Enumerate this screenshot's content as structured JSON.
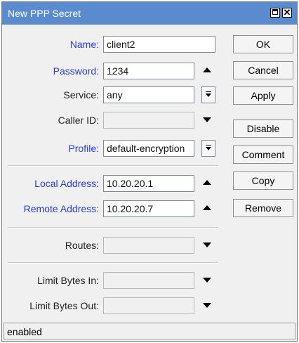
{
  "window": {
    "title": "New PPP Secret",
    "maximize_icon": "maximize-icon",
    "close_icon": "close-icon",
    "close_glyph": "✕"
  },
  "form": {
    "name": {
      "label": "Name:",
      "value": "client2"
    },
    "password": {
      "label": "Password:",
      "value": "1234"
    },
    "service": {
      "label": "Service:",
      "value": "any"
    },
    "caller_id": {
      "label": "Caller ID:",
      "value": ""
    },
    "profile": {
      "label": "Profile:",
      "value": "default-encryption"
    },
    "local_address": {
      "label": "Local Address:",
      "value": "10.20.20.1"
    },
    "remote_address": {
      "label": "Remote Address:",
      "value": "10.20.20.7"
    },
    "routes": {
      "label": "Routes:",
      "value": ""
    },
    "limit_bytes_in": {
      "label": "Limit Bytes In:",
      "value": ""
    },
    "limit_bytes_out": {
      "label": "Limit Bytes Out:",
      "value": ""
    }
  },
  "buttons": {
    "ok": "OK",
    "cancel": "Cancel",
    "apply": "Apply",
    "disable": "Disable",
    "comment": "Comment",
    "copy": "Copy",
    "remove": "Remove"
  },
  "status": {
    "text": "enabled"
  },
  "colors": {
    "titlebar": "#5a8bcf",
    "label_blue": "#2b3ddb",
    "window_bg": "#f0f0f0"
  }
}
